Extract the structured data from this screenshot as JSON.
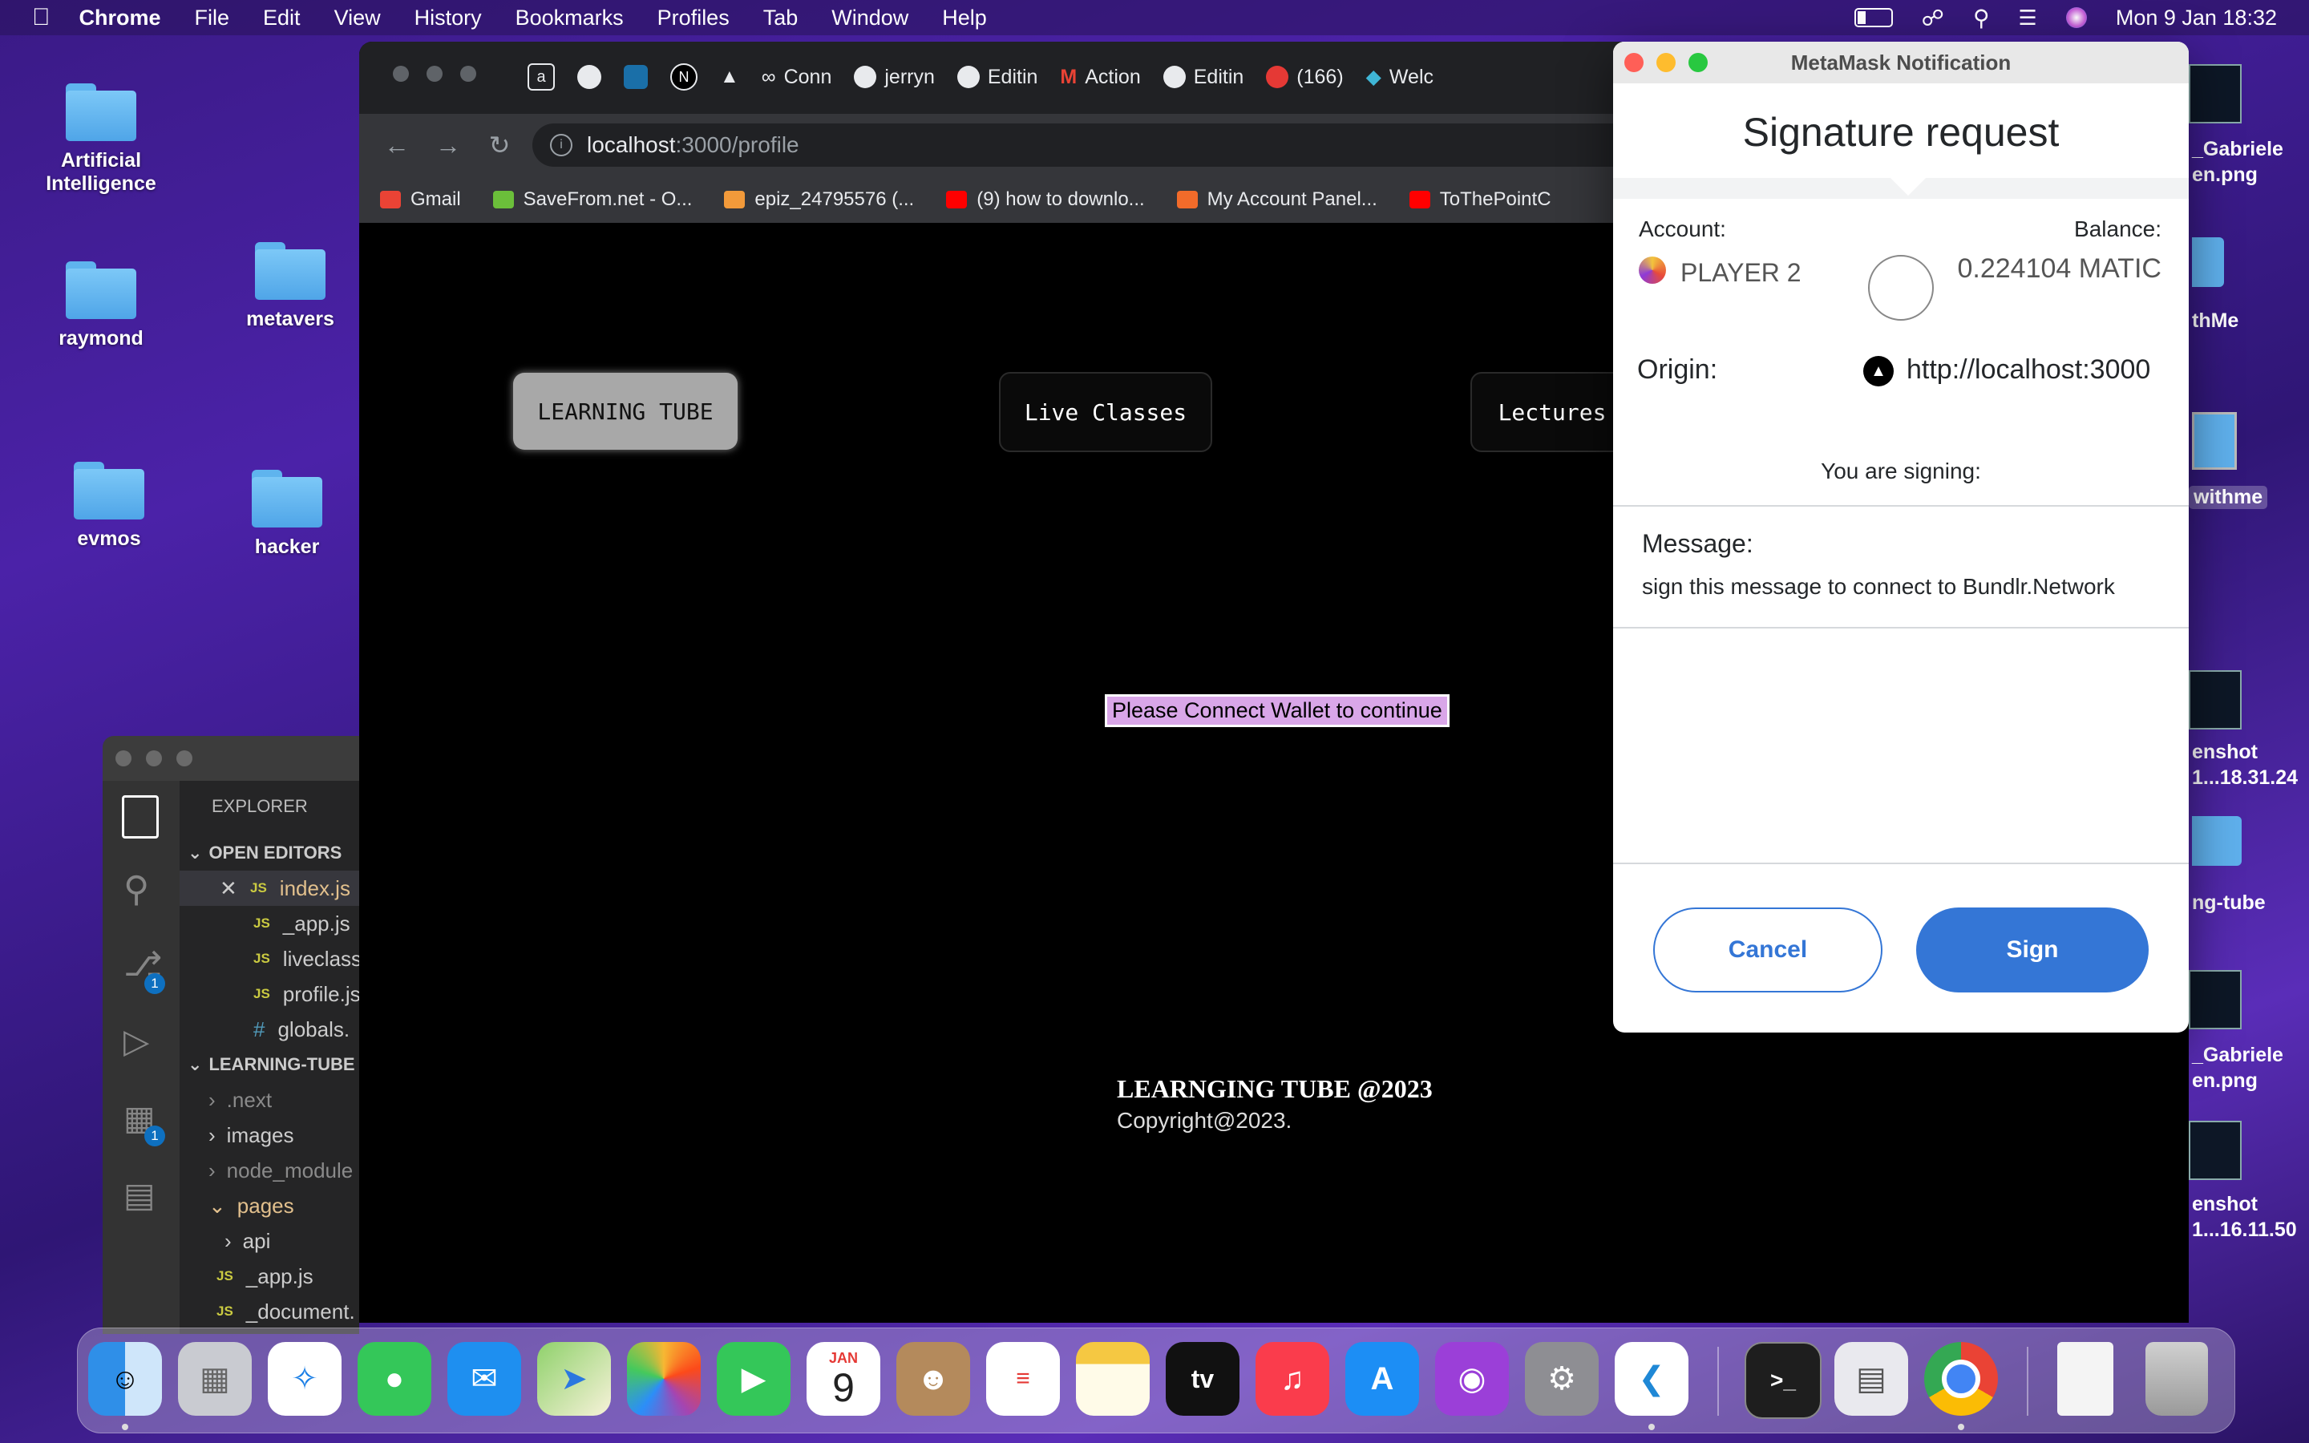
{
  "menubar": {
    "app": "Chrome",
    "items": [
      "File",
      "Edit",
      "View",
      "History",
      "Bookmarks",
      "Profiles",
      "Tab",
      "Window",
      "Help"
    ],
    "clock": "Mon 9 Jan  18:32"
  },
  "desktop": {
    "icons": [
      "Artificial Intelligence",
      "raymond",
      "metavers",
      "evmos",
      "hacker"
    ],
    "right_labels": [
      "_Gabriele",
      "en.png",
      "thMe",
      "withme",
      "enshot",
      "1...18.31.24",
      "ng-tube",
      "_Gabriele",
      "en.png",
      "enshot",
      "1...16.11.50"
    ]
  },
  "chrome": {
    "tabs": [
      "Conn",
      "jerryn",
      "Editin",
      "Action",
      "Editin",
      "(166)",
      "Welc"
    ],
    "url_host": "localhost",
    "url_path": ":3000/profile",
    "bookmarks": [
      {
        "label": "Gmail",
        "color": "#ea4335"
      },
      {
        "label": "SaveFrom.net - O...",
        "color": "#6bbf3a"
      },
      {
        "label": "epiz_24795576 (...",
        "color": "#f29a3a"
      },
      {
        "label": "(9) how to downlo...",
        "color": "#ff0000"
      },
      {
        "label": "My Account Panel...",
        "color": "#f26b2a"
      },
      {
        "label": "ToThePointC",
        "color": "#ff0000"
      }
    ]
  },
  "page": {
    "nav": [
      "LEARNING TUBE",
      "Live Classes",
      "Lectures"
    ],
    "notice": "Please Connect Wallet to continue",
    "footer_title": "LEARNGING TUBE @2023",
    "footer_copy": "Copyright@2023."
  },
  "metamask": {
    "window_title": "MetaMask Notification",
    "heading": "Signature request",
    "account_label": "Account:",
    "account_name": "PLAYER 2",
    "balance_label": "Balance:",
    "balance_value": "0.224104 MATIC",
    "origin_label": "Origin:",
    "origin_value": "http://localhost:3000",
    "signing_label": "You are signing:",
    "message_label": "Message:",
    "message_text": "sign this message to connect to Bundlr.Network",
    "cancel": "Cancel",
    "sign": "Sign",
    "accent": "#3476d6"
  },
  "vscode": {
    "explorer": "EXPLORER",
    "open_editors": "OPEN EDITORS",
    "files": [
      "index.js",
      "_app.js",
      "liveclass",
      "profile.js",
      "globals."
    ],
    "project": "LEARNING-TUBE",
    "tree": [
      ".next",
      "images",
      "node_module",
      "pages",
      "api",
      "_app.js",
      "_document."
    ],
    "badge": "1",
    "bottom_line": "20"
  },
  "dock": {
    "calendar_month": "JAN",
    "calendar_day": "9",
    "tv": "tv"
  }
}
